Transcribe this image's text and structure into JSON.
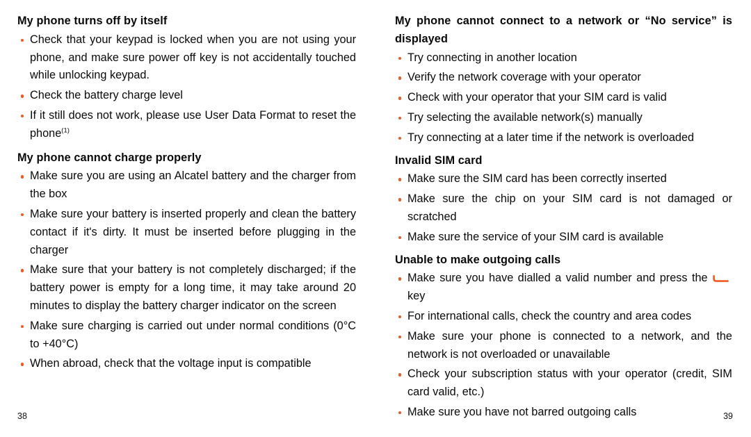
{
  "document": {
    "type": "user-manual-spread",
    "bullet_color": "#f05a22",
    "text_color": "#0a0a0a",
    "background": "#ffffff"
  },
  "left_page": {
    "folio": "38",
    "sections": [
      {
        "heading": "My phone turns off by itself",
        "bullets": [
          "Check that your keypad is locked when you are not using your phone, and make sure power off key is not accidentally touched while unlocking keypad.",
          "Check the battery charge level",
          "If it still does not work, please use User Data Format to reset the phone"
        ],
        "footnote_marker": "(1)",
        "footnote_on_bullet_index": 2
      },
      {
        "heading": "My phone cannot charge properly",
        "bullets": [
          "Make sure you are using an Alcatel battery and the charger from the box",
          "Make sure your battery is inserted properly and clean the battery contact if it's dirty. It must be inserted before plugging in the charger",
          "Make sure that your battery is not completely discharged; if the battery power is empty for a long time, it may take around 20 minutes to display the battery charger indicator on the screen",
          "Make sure charging is carried out under normal conditions (0°C to +40°C)",
          "When abroad, check that the voltage input is compatible"
        ]
      }
    ]
  },
  "right_page": {
    "folio": "39",
    "sections": [
      {
        "heading": "My phone cannot connect to a network or “No service” is displayed",
        "bullets": [
          "Try connecting in another location",
          "Verify the network coverage with your operator",
          "Check with your operator that your SIM card is valid",
          "Try selecting the available network(s) manually",
          "Try connecting at a later time if the network is overloaded"
        ]
      },
      {
        "heading": "Invalid SIM card",
        "bullets": [
          "Make sure the SIM card has been correctly inserted",
          "Make sure the chip on your SIM card is not damaged or scratched",
          "Make sure the service of your SIM card is available"
        ]
      },
      {
        "heading": "Unable to make outgoing calls",
        "bullets": [
          {
            "text_before_icon": "Make sure you have dialled a valid number and press the",
            "icon": "call-send-key-icon",
            "text_after_icon": "key"
          },
          "For international calls, check the country and area codes",
          "Make sure your phone is connected to a network, and the network is not overloaded or unavailable",
          "Check your subscription status with your operator (credit, SIM card valid, etc.)",
          "Make sure you have not barred outgoing calls"
        ]
      }
    ]
  }
}
